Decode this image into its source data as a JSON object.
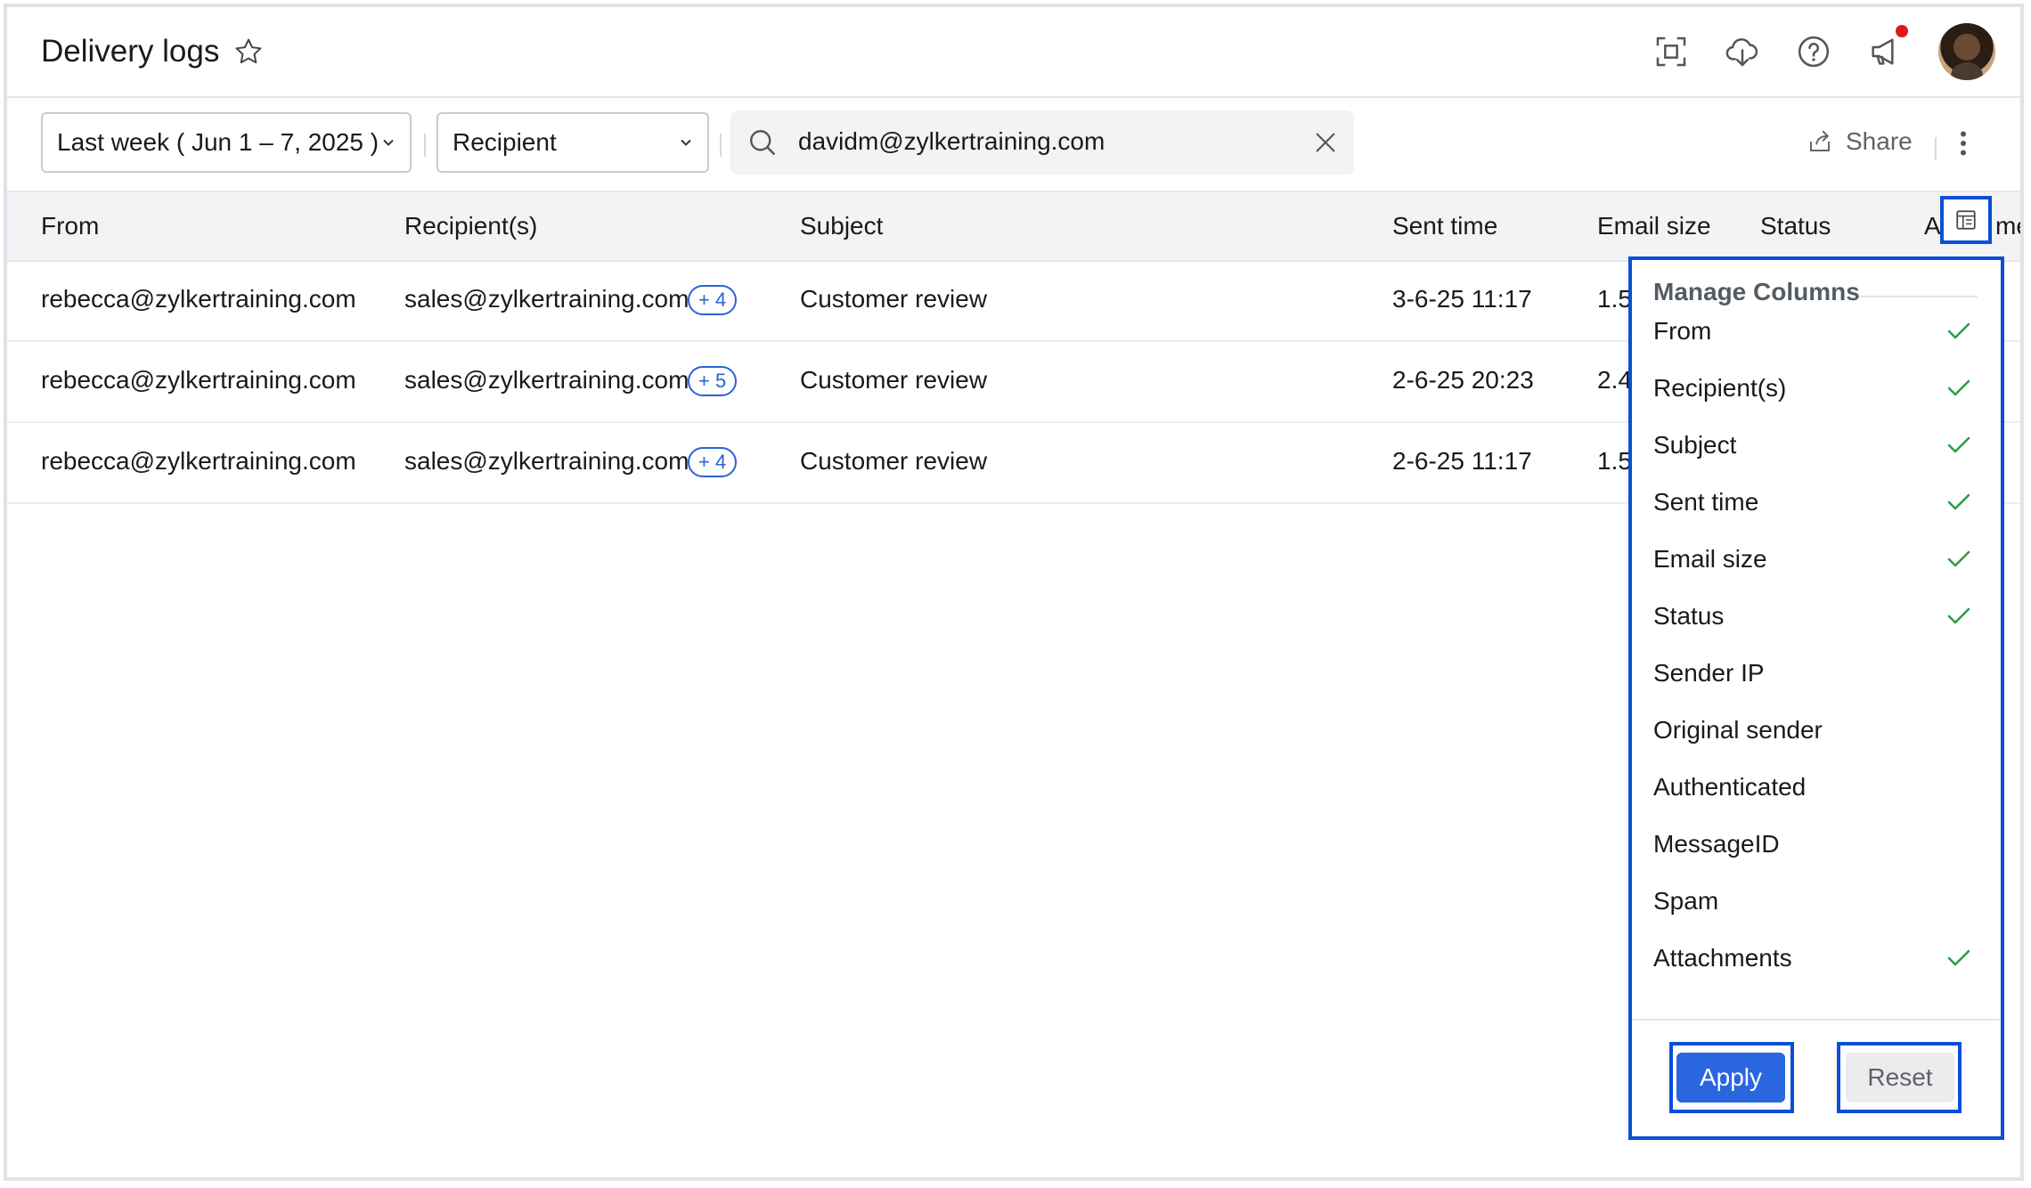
{
  "header": {
    "title": "Delivery logs",
    "icons": [
      "star-icon",
      "fullscreen-icon",
      "cloud-download-icon",
      "help-icon",
      "announcement-icon",
      "avatar"
    ]
  },
  "toolbar": {
    "date_filter": "Last week ( Jun 1 – 7, 2025 )",
    "type_filter": "Recipient",
    "search_value": "davidm@zylkertraining.com",
    "share_label": "Share"
  },
  "table": {
    "columns": [
      "From",
      "Recipient(s)",
      "Subject",
      "Sent time",
      "Email size",
      "Status",
      "A",
      "me"
    ],
    "rows": [
      {
        "from": "rebecca@zylkertraining.com",
        "recipient": "sales@zylkertraining.com",
        "extra": "+ 4",
        "subject": "Customer review",
        "sent": "3-6-25 11:17",
        "size": "1.5"
      },
      {
        "from": "rebecca@zylkertraining.com",
        "recipient": "sales@zylkertraining.com",
        "extra": "+ 5",
        "subject": "Customer review",
        "sent": "2-6-25 20:23",
        "size": "2.4"
      },
      {
        "from": "rebecca@zylkertraining.com",
        "recipient": "sales@zylkertraining.com",
        "extra": "+ 4",
        "subject": "Customer review",
        "sent": "2-6-25 11:17",
        "size": "1.5"
      }
    ]
  },
  "manage_columns": {
    "title": "Manage Columns",
    "options": [
      {
        "label": "From",
        "checked": true
      },
      {
        "label": "Recipient(s)",
        "checked": true
      },
      {
        "label": "Subject",
        "checked": true
      },
      {
        "label": "Sent time",
        "checked": true
      },
      {
        "label": "Email size",
        "checked": true
      },
      {
        "label": "Status",
        "checked": true
      },
      {
        "label": "Sender IP",
        "checked": false
      },
      {
        "label": "Original sender",
        "checked": false
      },
      {
        "label": "Authenticated",
        "checked": false
      },
      {
        "label": "MessageID",
        "checked": false
      },
      {
        "label": "Spam",
        "checked": false
      },
      {
        "label": "Attachments",
        "checked": true
      }
    ],
    "apply_label": "Apply",
    "reset_label": "Reset"
  },
  "colors": {
    "accent": "#2a66e0",
    "highlight": "#0a4fd6",
    "check": "#2e9e44",
    "notification": "#e0171f"
  }
}
